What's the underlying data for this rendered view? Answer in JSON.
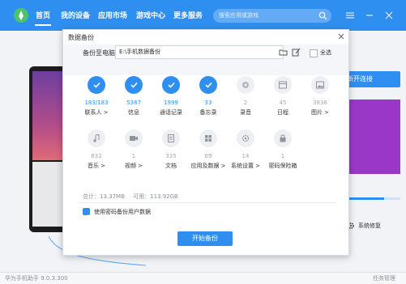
{
  "app": {
    "nav": [
      "首页",
      "我的设备",
      "应用市场",
      "游戏中心",
      "更多服务"
    ],
    "search_placeholder": "搜索应用或游戏",
    "footer_left": "华为手机助手 9.0.3.300",
    "footer_right": "任务管理",
    "connect_label": "断开连接",
    "repair_label": "系统修复",
    "progress": 0.7,
    "accent": "#2f8ff0"
  },
  "dialog": {
    "title": "数据备份",
    "backup_to_label": "备份至电脑",
    "path": "E:\\手机数据备份",
    "select_all_label": "全选",
    "items_row1": [
      {
        "count": "183/183",
        "label": "联系人 >",
        "on": true,
        "icon": "check-icon"
      },
      {
        "count": "5387",
        "label": "信息",
        "on": true,
        "icon": "check-icon"
      },
      {
        "count": "1999",
        "label": "通话记录",
        "on": true,
        "icon": "check-icon"
      },
      {
        "count": "33",
        "label": "备忘录",
        "on": true,
        "icon": "check-icon"
      },
      {
        "count": "2",
        "label": "录音",
        "on": false,
        "icon": "recorder-icon"
      },
      {
        "count": "45",
        "label": "日程",
        "on": false,
        "icon": "calendar-icon"
      },
      {
        "count": "3836",
        "label": "图片 >",
        "on": false,
        "icon": "image-icon"
      }
    ],
    "items_row2": [
      {
        "count": "832",
        "label": "音乐 >",
        "on": false,
        "icon": "music-icon"
      },
      {
        "count": "1",
        "label": "视频 >",
        "on": false,
        "icon": "video-icon"
      },
      {
        "count": "335",
        "label": "文档",
        "on": false,
        "icon": "document-icon"
      },
      {
        "count": "69",
        "label": "应用及数据 >",
        "on": false,
        "icon": "apps-icon"
      },
      {
        "count": "14",
        "label": "系统设置 >",
        "on": false,
        "icon": "settings-icon"
      },
      {
        "count": "1",
        "label": "密码保险箱",
        "on": false,
        "icon": "lock-icon"
      }
    ],
    "total_label": "总计：13.37MB",
    "available_label": "可用：113.92GB",
    "encrypt_label": "使用密码备份用户数据",
    "start_label": "开始备份"
  }
}
